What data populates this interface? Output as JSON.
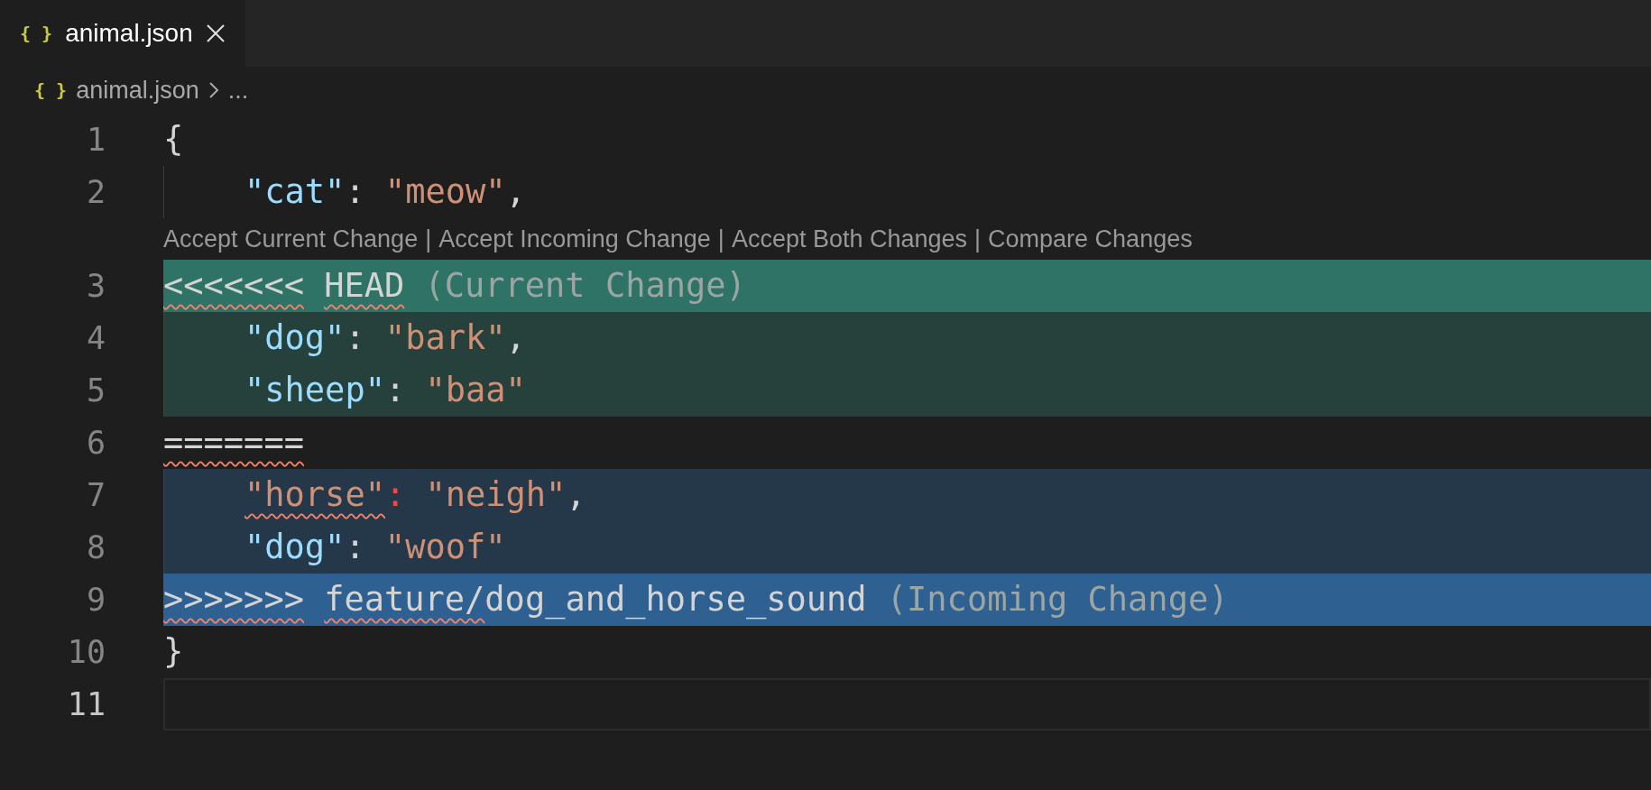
{
  "tabs": [
    {
      "icon": "{ }",
      "label": "animal.json",
      "selected": true
    }
  ],
  "breadcrumb": {
    "icon": "{ }",
    "file": "animal.json",
    "more": "..."
  },
  "lines": [
    {
      "number": "1",
      "kind": "plain",
      "indent": false,
      "selected": false,
      "tokens": [
        {
          "text": "{",
          "kind": "punct",
          "squiggle": false
        }
      ]
    },
    {
      "number": "2",
      "kind": "plain",
      "indent": true,
      "selected": false,
      "tokens": [
        {
          "text": "\"cat\"",
          "kind": "key",
          "squiggle": false
        },
        {
          "text": ":",
          "kind": "punct",
          "squiggle": false
        },
        {
          "text": "\"meow\"",
          "kind": "string",
          "squiggle": false,
          "space_before": true
        },
        {
          "text": ",",
          "kind": "punct",
          "squiggle": false
        }
      ],
      "codelens": {
        "separator": "|",
        "actions": [
          "Accept Current Change",
          "Accept Incoming Change",
          "Accept Both Changes",
          "Compare Changes"
        ]
      }
    },
    {
      "number": "3",
      "kind": "current_header",
      "indent": false,
      "selected": false,
      "tokens": [
        {
          "text": "<<<<<<<",
          "kind": "punct",
          "squiggle": true
        },
        {
          "text": "HEAD",
          "kind": "punct",
          "squiggle": true,
          "space_before": true
        },
        {
          "text": "(Current Change)",
          "kind": "comment",
          "squiggle": false,
          "space_before": true
        }
      ]
    },
    {
      "number": "4",
      "kind": "current",
      "indent": true,
      "selected": false,
      "tokens": [
        {
          "text": "\"dog\"",
          "kind": "key",
          "squiggle": false
        },
        {
          "text": ":",
          "kind": "punct",
          "squiggle": false
        },
        {
          "text": "\"bark\"",
          "kind": "string",
          "squiggle": false,
          "space_before": true
        },
        {
          "text": ",",
          "kind": "punct",
          "squiggle": false
        }
      ]
    },
    {
      "number": "5",
      "kind": "current",
      "indent": true,
      "selected": false,
      "tokens": [
        {
          "text": "\"sheep\"",
          "kind": "key",
          "squiggle": false
        },
        {
          "text": ":",
          "kind": "punct",
          "squiggle": false
        },
        {
          "text": "\"baa\"",
          "kind": "string",
          "squiggle": false,
          "space_before": true
        }
      ]
    },
    {
      "number": "6",
      "kind": "plain",
      "indent": false,
      "selected": false,
      "tokens": [
        {
          "text": "=======",
          "kind": "punct",
          "squiggle": true
        }
      ]
    },
    {
      "number": "7",
      "kind": "incoming",
      "indent": true,
      "selected": false,
      "tokens": [
        {
          "text": "\"horse\"",
          "kind": "string",
          "squiggle": true
        },
        {
          "text": ":",
          "kind": "error",
          "squiggle": false
        },
        {
          "text": "\"neigh\"",
          "kind": "string",
          "squiggle": false,
          "space_before": true
        },
        {
          "text": ",",
          "kind": "punct",
          "squiggle": false
        }
      ]
    },
    {
      "number": "8",
      "kind": "incoming",
      "indent": true,
      "selected": false,
      "tokens": [
        {
          "text": "\"dog\"",
          "kind": "key",
          "squiggle": false
        },
        {
          "text": ":",
          "kind": "punct",
          "squiggle": false
        },
        {
          "text": "\"woof\"",
          "kind": "string",
          "squiggle": false,
          "space_before": true
        }
      ]
    },
    {
      "number": "9",
      "kind": "incoming_header",
      "indent": false,
      "selected": false,
      "tokens": [
        {
          "text": ">>>>>>>",
          "kind": "punct",
          "squiggle": true
        },
        {
          "text": "feature/",
          "kind": "punct",
          "squiggle": true,
          "space_before": true
        },
        {
          "text": "dog_and_horse_sound",
          "kind": "punct",
          "squiggle": false
        },
        {
          "text": "(Incoming Change)",
          "kind": "comment",
          "squiggle": false,
          "space_before": true
        }
      ]
    },
    {
      "number": "10",
      "kind": "plain",
      "indent": false,
      "selected": false,
      "tokens": [
        {
          "text": "}",
          "kind": "punct",
          "squiggle": false
        }
      ]
    },
    {
      "number": "11",
      "kind": "plain",
      "indent": false,
      "selected": true
    }
  ]
}
